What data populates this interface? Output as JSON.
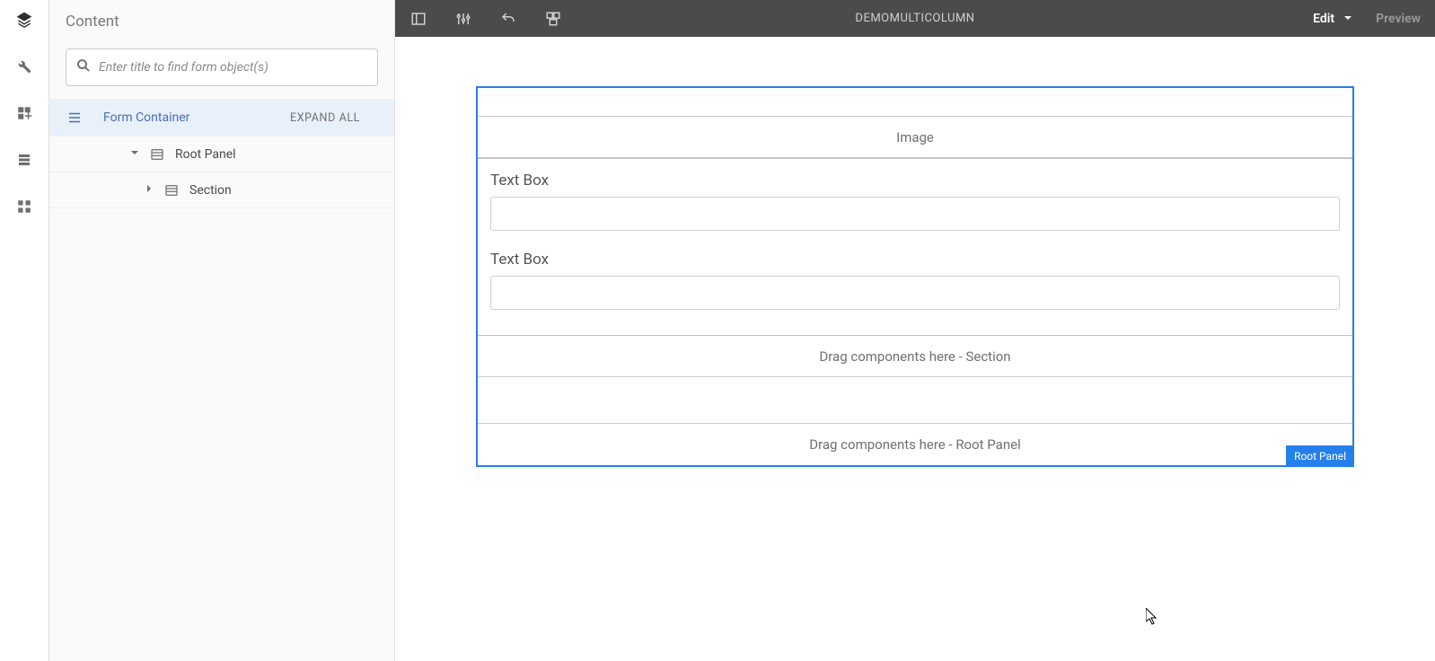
{
  "rail": {
    "items": [
      "layers-icon",
      "wrench-icon",
      "assets-icon",
      "components-icon",
      "fragments-icon"
    ]
  },
  "sidebar": {
    "title": "Content",
    "search_placeholder": "Enter title to find form object(s)",
    "form_container_label": "Form Container",
    "expand_all_label": "EXPAND ALL",
    "tree": [
      {
        "label": "Root Panel",
        "expanded": true
      },
      {
        "label": "Section",
        "expanded": false
      }
    ]
  },
  "topbar": {
    "title": "DEMOMULTICOLUMN",
    "edit_label": "Edit",
    "preview_label": "Preview"
  },
  "canvas": {
    "image_label": "Image",
    "fields": [
      {
        "label": "Text Box"
      },
      {
        "label": "Text Box"
      }
    ],
    "section_drop_label": "Drag components here - Section",
    "root_drop_label": "Drag components here - Root Panel",
    "root_badge_label": "Root Panel"
  }
}
